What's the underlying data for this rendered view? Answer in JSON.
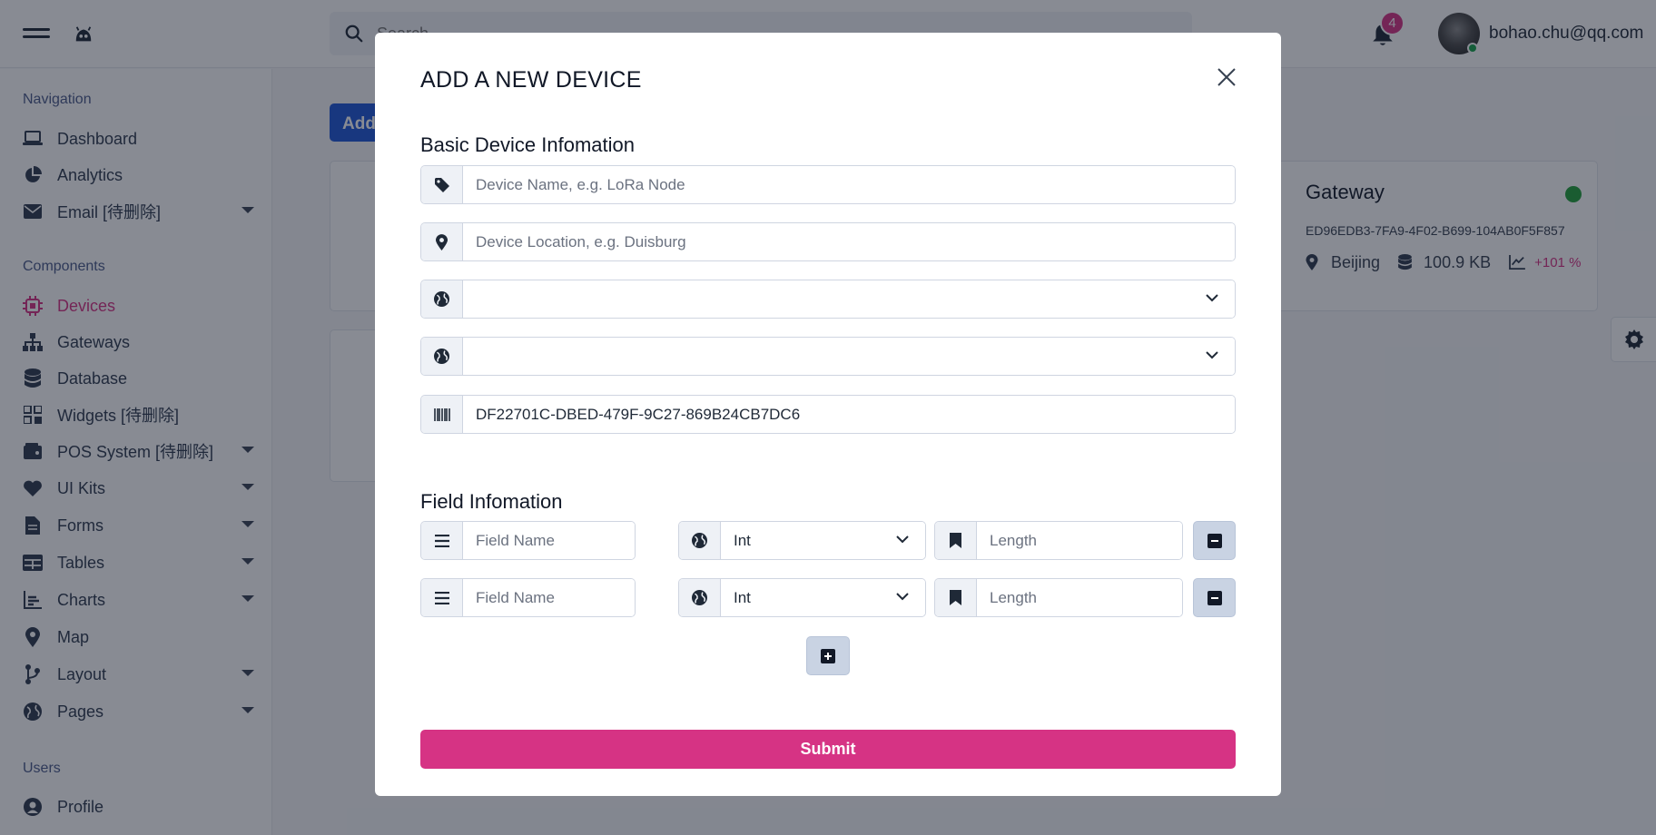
{
  "topbar": {
    "search_placeholder": "Search",
    "notification_count": "4",
    "user_email": "bohao.chu@qq.com"
  },
  "sidebar": {
    "sections": [
      {
        "heading": "Navigation",
        "items": [
          {
            "label": "Dashboard",
            "icon": "laptop-icon",
            "has_submenu": false
          },
          {
            "label": "Analytics",
            "icon": "pie-chart-icon",
            "has_submenu": false
          },
          {
            "label": "Email [待删除]",
            "icon": "envelope-icon",
            "has_submenu": true
          }
        ]
      },
      {
        "heading": "Components",
        "items": [
          {
            "label": "Devices",
            "icon": "chip-icon",
            "has_submenu": false,
            "active": true
          },
          {
            "label": "Gateways",
            "icon": "sitemap-icon",
            "has_submenu": false
          },
          {
            "label": "Database",
            "icon": "database-icon",
            "has_submenu": false
          },
          {
            "label": "Widgets [待删除]",
            "icon": "widgets-icon",
            "has_submenu": false
          },
          {
            "label": "POS System [待删除]",
            "icon": "wallet-icon",
            "has_submenu": true
          },
          {
            "label": "UI Kits",
            "icon": "heart-icon",
            "has_submenu": true
          },
          {
            "label": "Forms",
            "icon": "file-icon",
            "has_submenu": true
          },
          {
            "label": "Tables",
            "icon": "table-icon",
            "has_submenu": true
          },
          {
            "label": "Charts",
            "icon": "chart-icon",
            "has_submenu": true
          },
          {
            "label": "Map",
            "icon": "map-pin-icon",
            "has_submenu": false
          },
          {
            "label": "Layout",
            "icon": "branch-icon",
            "has_submenu": true
          },
          {
            "label": "Pages",
            "icon": "globe-icon",
            "has_submenu": true
          }
        ]
      },
      {
        "heading": "Users",
        "items": [
          {
            "label": "Profile",
            "icon": "user-circle-icon",
            "has_submenu": false
          }
        ]
      }
    ]
  },
  "main": {
    "add_button_label": "Add",
    "gateway_card": {
      "title": "Gateway",
      "id": "ED96EDB3-7FA9-4F02-B699-104AB0F5F857",
      "location": "Beijing",
      "size": "100.9 KB",
      "change": "+101 %",
      "status_color": "#22a03a"
    }
  },
  "modal": {
    "title": "ADD A NEW DEVICE",
    "basic_section_title": "Basic Device Infomation",
    "device_name_placeholder": "Device Name, e.g. LoRa Node",
    "device_location_placeholder": "Device Location, e.g. Duisburg",
    "select_1_value": "",
    "select_2_value": "",
    "device_id_value": "DF22701C-DBED-479F-9C27-869B24CB7DC6",
    "field_section_title": "Field Infomation",
    "fields": [
      {
        "name_placeholder": "Field Name",
        "type_value": "Int",
        "length_placeholder": "Length"
      },
      {
        "name_placeholder": "Field Name",
        "type_value": "Int",
        "length_placeholder": "Length"
      }
    ],
    "submit_label": "Submit"
  },
  "colors": {
    "accent": "#d63384",
    "primary": "#1f56d6",
    "muted_button": "#c9d3e3"
  }
}
